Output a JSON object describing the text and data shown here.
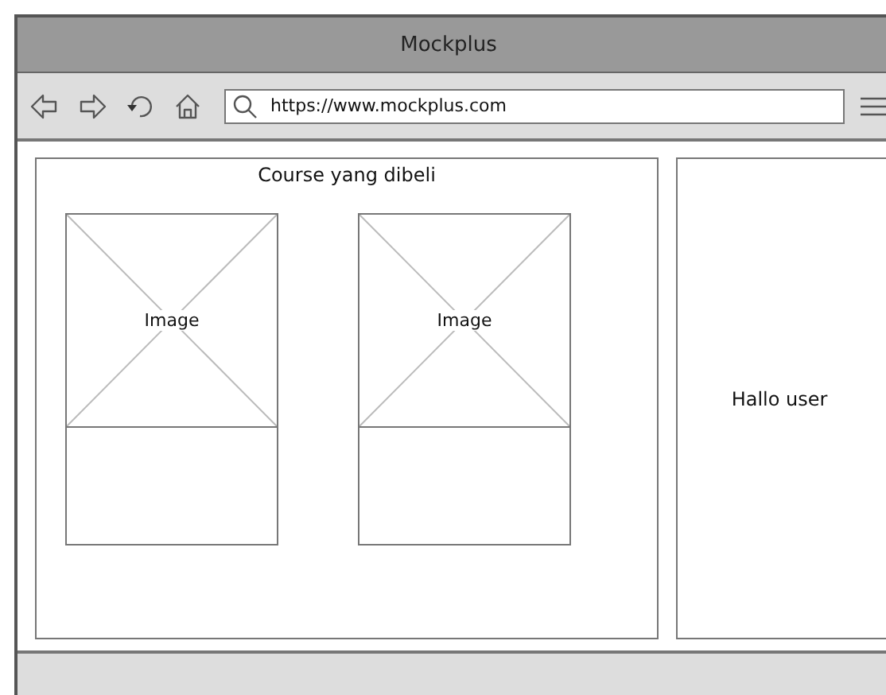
{
  "window": {
    "title": "Mockplus"
  },
  "address_bar": {
    "value": "https://www.mockplus.com"
  },
  "course_panel": {
    "title": "Course yang dibeli",
    "cards": [
      {
        "image_label": "Image"
      },
      {
        "image_label": "Image"
      }
    ]
  },
  "side_panel": {
    "text": "Hallo user"
  }
}
